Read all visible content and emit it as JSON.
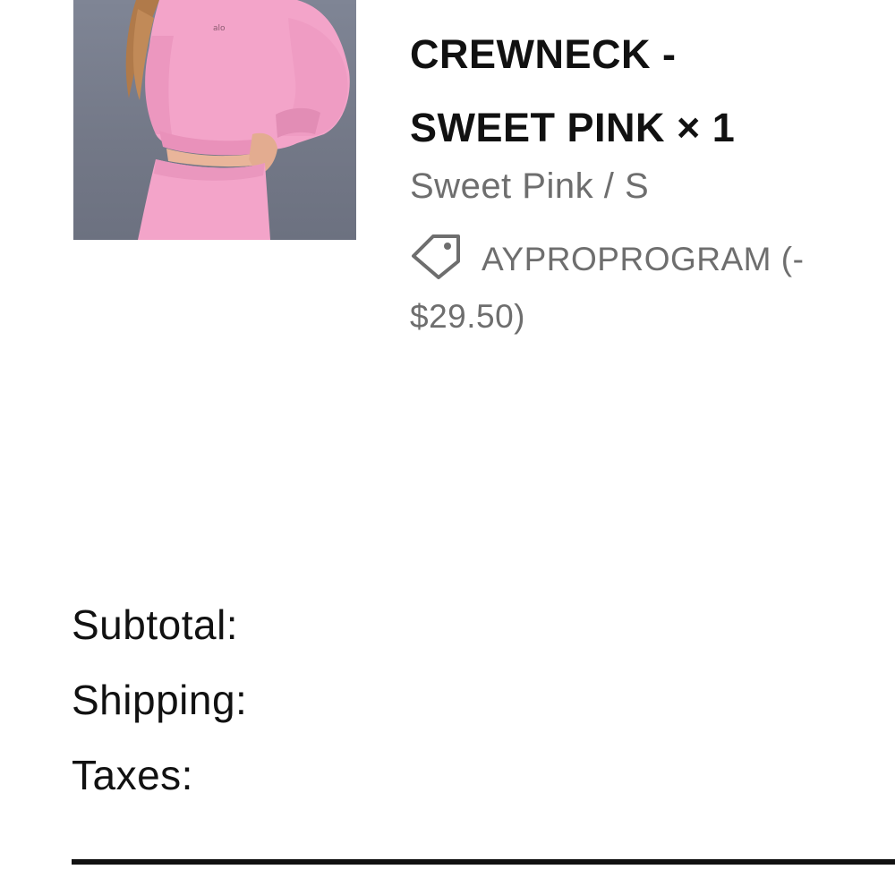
{
  "item": {
    "title_line1": "CREWNECK -",
    "title_line2": "SWEET PINK × 1",
    "variant": "Sweet Pink / S",
    "discount_line1": "AYPROPROGRAM (-",
    "discount_line2": "$29.50)",
    "icon": "price-tag-icon"
  },
  "summary": {
    "subtotal_label": "Subtotal:",
    "shipping_label": "Shipping:",
    "taxes_label": "Taxes:"
  },
  "colors": {
    "text": "#111111",
    "muted": "#6e6e6e",
    "image_background": "#737887",
    "garment_pink": "#f3a4c9"
  }
}
